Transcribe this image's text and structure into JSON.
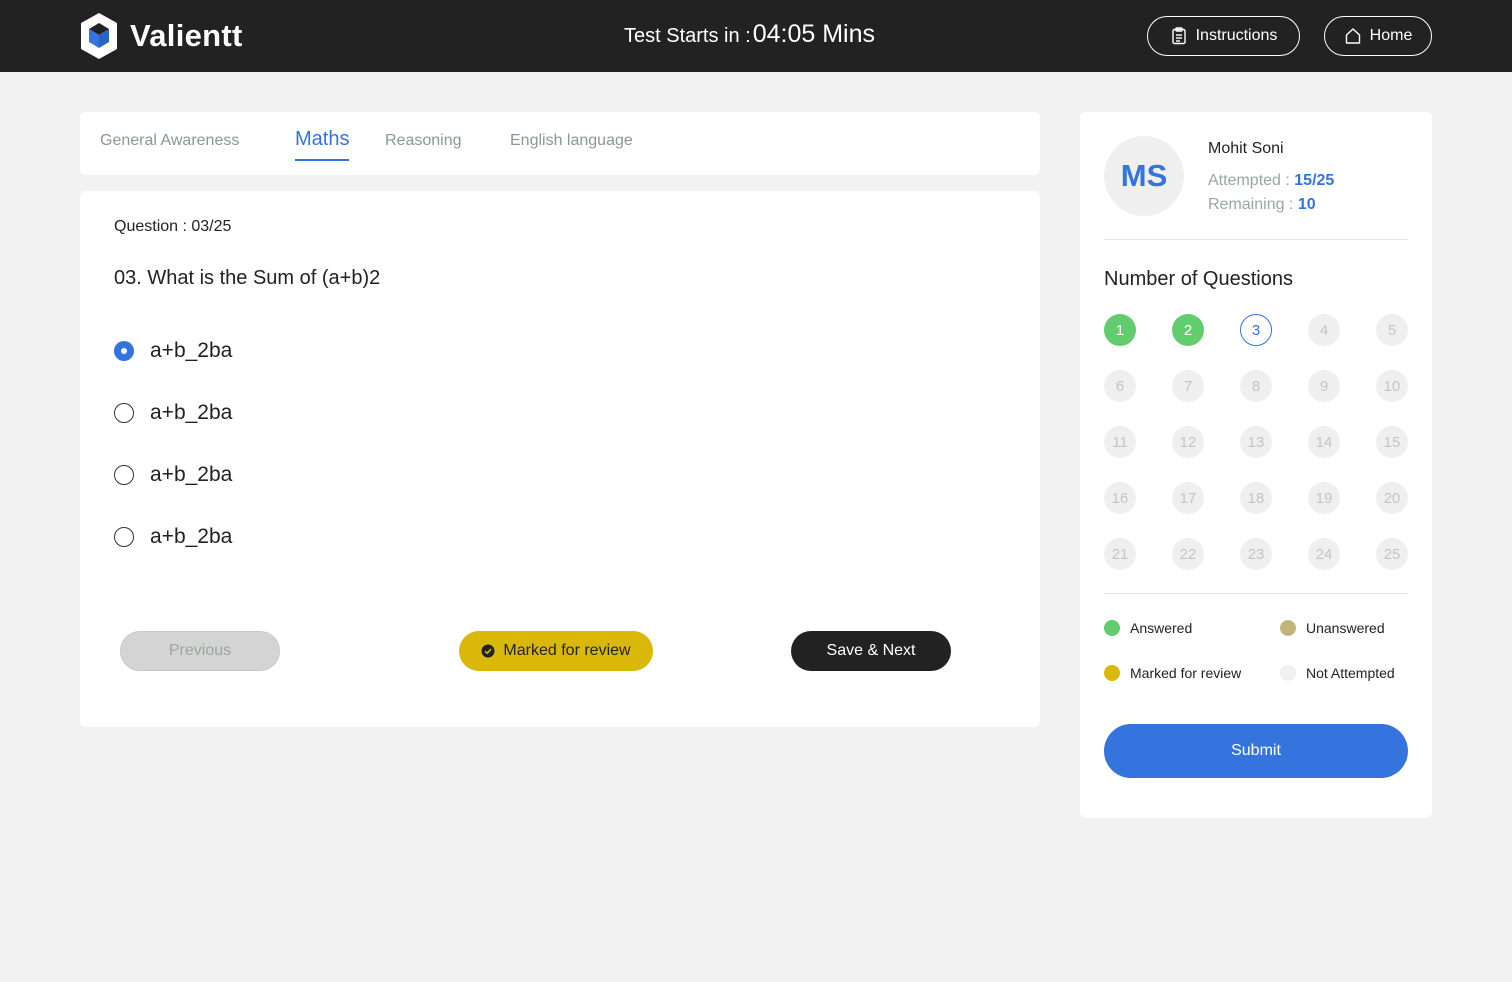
{
  "header": {
    "brand": "Valientt",
    "timer_label": "Test Starts in :",
    "timer_value": "04:05 Mins",
    "instructions_label": "Instructions",
    "home_label": "Home"
  },
  "tabs": [
    {
      "label": "General Awareness",
      "active": false
    },
    {
      "label": "Maths",
      "active": true
    },
    {
      "label": "Reasoning",
      "active": false
    },
    {
      "label": "English language",
      "active": false
    }
  ],
  "question": {
    "counter": "Question : 03/25",
    "text": "03. What is the Sum of (a+b)2",
    "options": [
      {
        "label": "a+b_2ba",
        "selected": true
      },
      {
        "label": "a+b_2ba",
        "selected": false
      },
      {
        "label": "a+b_2ba",
        "selected": false
      },
      {
        "label": "a+b_2ba",
        "selected": false
      }
    ]
  },
  "actions": {
    "previous_label": "Previous",
    "mark_label": "Marked for review",
    "save_next_label": "Save & Next"
  },
  "sidebar": {
    "avatar_initials": "MS",
    "user_name": "Mohit Soni",
    "attempted_label": "Attempted : ",
    "attempted_value": "15/25",
    "remaining_label": "Remaining : ",
    "remaining_value": "10",
    "questions_title": "Number of Questions",
    "questions": [
      {
        "n": "1",
        "status": "answered"
      },
      {
        "n": "2",
        "status": "answered"
      },
      {
        "n": "3",
        "status": "current"
      },
      {
        "n": "4",
        "status": "not-attempted"
      },
      {
        "n": "5",
        "status": "not-attempted"
      },
      {
        "n": "6",
        "status": "not-attempted"
      },
      {
        "n": "7",
        "status": "not-attempted"
      },
      {
        "n": "8",
        "status": "not-attempted"
      },
      {
        "n": "9",
        "status": "not-attempted"
      },
      {
        "n": "10",
        "status": "not-attempted"
      },
      {
        "n": "11",
        "status": "not-attempted"
      },
      {
        "n": "12",
        "status": "not-attempted"
      },
      {
        "n": "13",
        "status": "not-attempted"
      },
      {
        "n": "14",
        "status": "not-attempted"
      },
      {
        "n": "15",
        "status": "not-attempted"
      },
      {
        "n": "16",
        "status": "not-attempted"
      },
      {
        "n": "17",
        "status": "not-attempted"
      },
      {
        "n": "18",
        "status": "not-attempted"
      },
      {
        "n": "19",
        "status": "not-attempted"
      },
      {
        "n": "20",
        "status": "not-attempted"
      },
      {
        "n": "21",
        "status": "not-attempted"
      },
      {
        "n": "22",
        "status": "not-attempted"
      },
      {
        "n": "23",
        "status": "not-attempted"
      },
      {
        "n": "24",
        "status": "not-attempted"
      },
      {
        "n": "25",
        "status": "not-attempted"
      }
    ],
    "legend": [
      {
        "label": "Answered",
        "color": "#62cd6e"
      },
      {
        "label": "Unanswered",
        "color": "#c2b57a"
      },
      {
        "label": "Marked for review",
        "color": "#d9b80a"
      },
      {
        "label": "Not Attempted",
        "color": "#f0f0f0"
      }
    ],
    "submit_label": "Submit"
  },
  "colors": {
    "accent": "#3574de",
    "answered": "#62cd6e",
    "marked": "#d9b80a",
    "header_bg": "#222222"
  }
}
